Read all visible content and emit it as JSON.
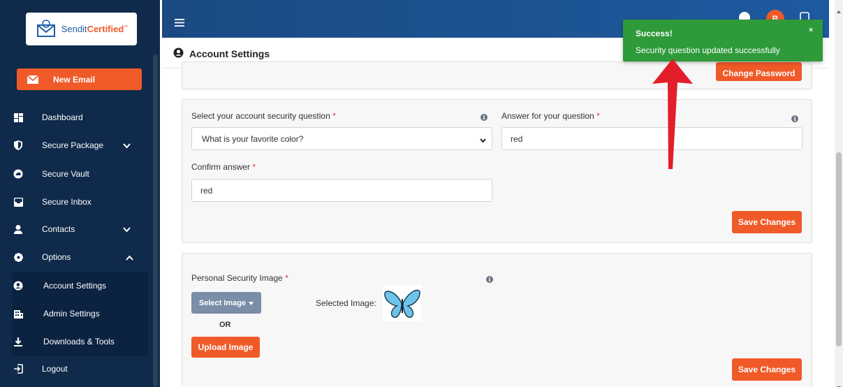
{
  "app": {
    "brand_part1": "Sendit",
    "brand_part2": "Certified",
    "brand_tm": "™"
  },
  "sidebar": {
    "new_email_label": "New Email",
    "items": [
      {
        "label": "Dashboard",
        "icon": "dashboard-icon"
      },
      {
        "label": "Secure Package",
        "icon": "shield-icon",
        "chevron": "down"
      },
      {
        "label": "Secure Vault",
        "icon": "cloud-icon"
      },
      {
        "label": "Secure Inbox",
        "icon": "inbox-icon"
      },
      {
        "label": "Contacts",
        "icon": "user-icon",
        "chevron": "down"
      },
      {
        "label": "Options",
        "icon": "gear-icon",
        "chevron": "up"
      },
      {
        "label": "Account Settings",
        "icon": "user-circle-icon",
        "sub": true
      },
      {
        "label": "Admin Settings",
        "icon": "building-icon",
        "sub": true
      },
      {
        "label": "Downloads & Tools",
        "icon": "download-icon",
        "sub": true
      },
      {
        "label": "Logout",
        "icon": "logout-icon"
      }
    ]
  },
  "header": {
    "page_title": "Account Settings",
    "avatar_letter": "B"
  },
  "password_card": {
    "change_password_label": "Change Password"
  },
  "security_question_card": {
    "question_label": "Select your account security question",
    "question_value": "What is your favorite color?",
    "answer_label": "Answer for your question",
    "answer_value": "red",
    "confirm_label": "Confirm answer",
    "confirm_value": "red",
    "required_mark": "*",
    "save_label": "Save Changes"
  },
  "security_image_card": {
    "label": "Personal Security Image",
    "required_mark": "*",
    "select_image_label": "Select Image",
    "or_label": "OR",
    "upload_label": "Upload Image",
    "selected_image_label": "Selected Image:",
    "save_label": "Save Changes"
  },
  "toast": {
    "title": "Success!",
    "message": "Security question updated successfully",
    "close": "×"
  },
  "colors": {
    "sidebar_bg": "#0f2a4a",
    "accent_orange": "#f05a28",
    "toast_green": "#2e9a3a",
    "topbar_blue": "#1e5aa0"
  }
}
